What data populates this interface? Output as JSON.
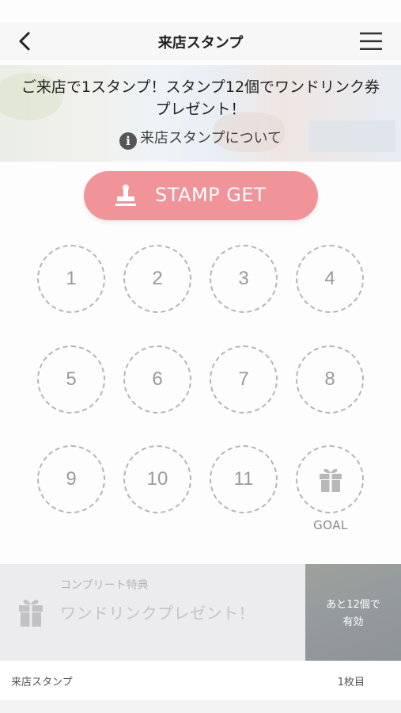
{
  "header": {
    "title": "来店スタンプ",
    "back_icon": "chevron-left-icon",
    "menu_icon": "hamburger-menu-icon"
  },
  "banner": {
    "text": "ご来店で1スタンプ！スタンプ12個でワンドリンク券プレゼント！",
    "info_glyph": "i",
    "link_label": "来店スタンプについて"
  },
  "stamp_button": {
    "label": "STAMP GET",
    "icon": "stamp-icon",
    "color": "#f1949a"
  },
  "stamps": {
    "slots": [
      "1",
      "2",
      "3",
      "4",
      "5",
      "6",
      "7",
      "8",
      "9",
      "10",
      "11"
    ],
    "goal_label": "GOAL",
    "goal_icon": "gift-icon",
    "collected": 0
  },
  "complete": {
    "subtitle": "コンプリート特典",
    "title": "ワンドリンクプレゼント！",
    "remaining_line1": "あと12個で",
    "remaining_line2": "有効",
    "icon": "gift-icon"
  },
  "footer": {
    "label": "来店スタンプ",
    "card_count": "1枚目"
  }
}
